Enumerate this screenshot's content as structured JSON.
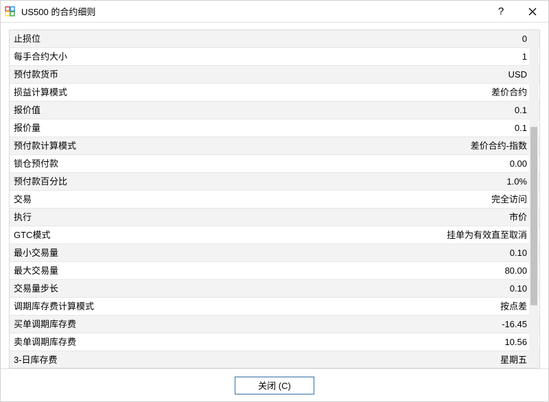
{
  "window": {
    "title": "US500 的合约细则",
    "help_label": "?",
    "close_label": "✕"
  },
  "rows": [
    {
      "label": "止损位",
      "value": "0"
    },
    {
      "label": "每手合约大小",
      "value": "1"
    },
    {
      "label": "预付款货币",
      "value": "USD"
    },
    {
      "label": "损益计算模式",
      "value": "差价合约"
    },
    {
      "label": "报价值",
      "value": "0.1"
    },
    {
      "label": "报价量",
      "value": "0.1"
    },
    {
      "label": "预付款计算模式",
      "value": "差价合约-指数"
    },
    {
      "label": "锁仓预付款",
      "value": "0.00"
    },
    {
      "label": "预付款百分比",
      "value": "1.0%"
    },
    {
      "label": "交易",
      "value": "完全访问"
    },
    {
      "label": "执行",
      "value": "市价"
    },
    {
      "label": "GTC模式",
      "value": "挂单为有效直至取消"
    },
    {
      "label": "最小交易量",
      "value": "0.10"
    },
    {
      "label": "最大交易量",
      "value": "80.00"
    },
    {
      "label": "交易量步长",
      "value": "0.10"
    },
    {
      "label": "调期库存费计算模式",
      "value": "按点差"
    },
    {
      "label": "买单调期库存费",
      "value": "-16.45"
    },
    {
      "label": "卖单调期库存费",
      "value": "10.56"
    },
    {
      "label": "3-日库存费",
      "value": "星期五"
    }
  ],
  "footer": {
    "close_button": "关闭 (C)"
  }
}
